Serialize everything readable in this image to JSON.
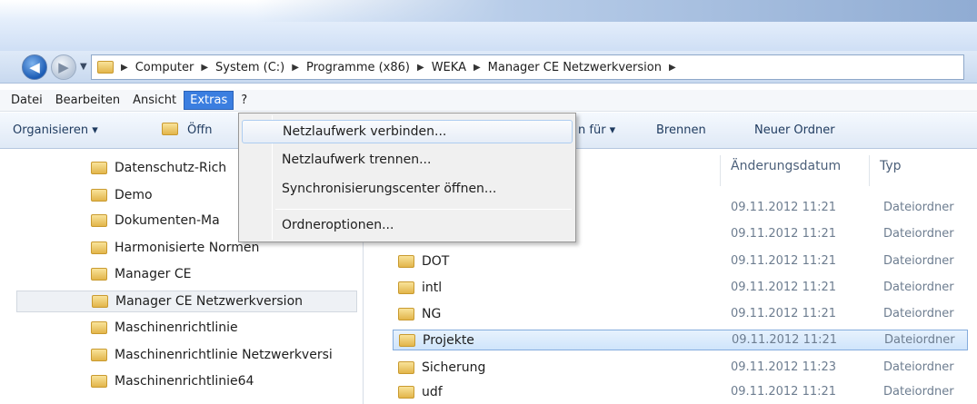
{
  "breadcrumb": [
    "Computer",
    "System (C:)",
    "Programme (x86)",
    "WEKA",
    "Manager CE Netzwerkversion"
  ],
  "menu": [
    "Datei",
    "Bearbeiten",
    "Ansicht",
    "Extras",
    "?"
  ],
  "toolbar": {
    "organize": "Organisieren ▾",
    "open": "Öffn",
    "share_partial": "n für ▾",
    "burn": "Brennen",
    "new_folder": "Neuer Ordner"
  },
  "dropdown": {
    "items": [
      "Netzlaufwerk verbinden...",
      "Netzlaufwerk trennen...",
      "Synchronisierungscenter öffnen...",
      "Ordneroptionen..."
    ]
  },
  "nav_tree": [
    "Datenschutz-Rich",
    "Demo",
    "Dokumenten-Ma",
    "Harmonisierte Normen",
    "Manager CE",
    "Manager CE Netzwerkversion",
    "Maschinenrichtlinie",
    "Maschinenrichtlinie Netzwerkversi",
    "Maschinenrichtlinie64"
  ],
  "columns": {
    "date": "Änderungsdatum",
    "type": "Typ"
  },
  "hidden_rows": [
    {
      "date": "09.11.2012 11:21",
      "type": "Dateiordner"
    },
    {
      "date": "09.11.2012 11:21",
      "type": "Dateiordner"
    }
  ],
  "files": [
    {
      "name": "DOT",
      "date": "09.11.2012 11:21",
      "type": "Dateiordner"
    },
    {
      "name": "intl",
      "date": "09.11.2012 11:21",
      "type": "Dateiordner"
    },
    {
      "name": "NG",
      "date": "09.11.2012 11:21",
      "type": "Dateiordner"
    },
    {
      "name": "Projekte",
      "date": "09.11.2012 11:21",
      "type": "Dateiordner"
    },
    {
      "name": "Sicherung",
      "date": "09.11.2012 11:23",
      "type": "Dateiordner"
    },
    {
      "name": "udf",
      "date": "09.11.2012 11:21",
      "type": "Dateiordner"
    }
  ]
}
